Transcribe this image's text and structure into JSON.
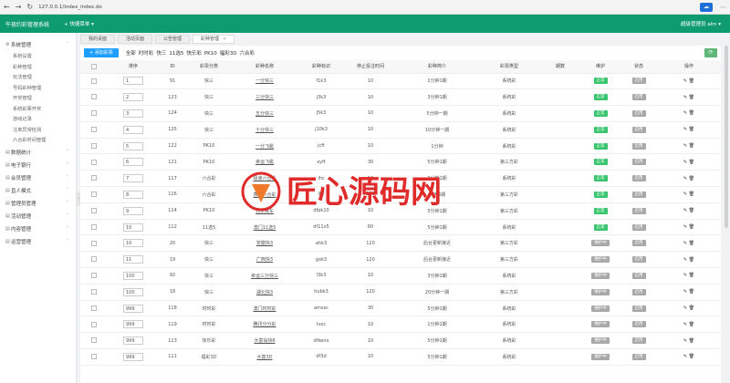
{
  "browser": {
    "url": "127.0.0.1/Index_index.do",
    "back": "←",
    "forward": "→",
    "reload": "↻",
    "menu": "⋯"
  },
  "header": {
    "brand": "午夜约彩管理系统",
    "quick_menu": "+ 快捷菜单 ▾",
    "user": "超级管理员   alm ▾"
  },
  "sidebar": {
    "groups": [
      {
        "label": "系统管理",
        "items": [
          "系统设置",
          "彩种管理",
          "玩法管理",
          "号码彩种管理",
          "开奖管理",
          "系统彩票开奖",
          "游戏记录",
          "注单异常检测",
          "六合彩时间管理"
        ]
      },
      {
        "label": "数据统计",
        "items": []
      },
      {
        "label": "电子银行",
        "items": []
      },
      {
        "label": "会员管理",
        "items": []
      },
      {
        "label": "直人模式",
        "items": []
      },
      {
        "label": "管理员管理",
        "items": []
      },
      {
        "label": "活动管理",
        "items": []
      },
      {
        "label": "内容管理",
        "items": []
      },
      {
        "label": "运营管理",
        "items": []
      }
    ]
  },
  "tabs": [
    "我的桌面",
    "活动页面",
    "公告管理",
    "彩种管理"
  ],
  "toolbar": {
    "add_label": "+ 添加彩票",
    "filters": [
      "全部",
      "时时彩",
      "快三",
      "11选5",
      "快乐彩",
      "PK10",
      "福彩3D",
      "六合彩"
    ],
    "refresh": "⟳"
  },
  "table": {
    "headers": [
      "",
      "排序",
      "ID",
      "彩票分类",
      "彩种名称",
      "彩种标识",
      "停止投注时间",
      "彩种简介",
      "彩票类型",
      "期数",
      "维护",
      "状态",
      "操作"
    ],
    "rows": [
      [
        "1",
        "91",
        "快三",
        "一分快三",
        "f1k3",
        "10",
        "1分钟1期",
        "系统彩",
        "",
        "正常",
        "启用"
      ],
      [
        "2",
        "123",
        "快三",
        "三分快三",
        "j3k3",
        "10",
        "3分钟1期",
        "系统彩",
        "",
        "正常",
        "启用"
      ],
      [
        "3",
        "124",
        "快三",
        "五分快三",
        "j5k3",
        "10",
        "5分钟一期",
        "系统彩",
        "",
        "正常",
        "启用"
      ],
      [
        "4",
        "125",
        "快三",
        "十分快三",
        "j10k3",
        "10",
        "10分钟一期",
        "系统彩",
        "",
        "正常",
        "启用"
      ],
      [
        "5",
        "122",
        "PK10",
        "一分飞艇",
        "jcft",
        "10",
        "1分钟",
        "系统彩",
        "",
        "正常",
        "启用"
      ],
      [
        "6",
        "121",
        "PK10",
        "幸运飞艇",
        "xyft",
        "30",
        "5分钟1期",
        "第三方彩",
        "",
        "正常",
        "启用"
      ],
      [
        "7",
        "117",
        "六合彩",
        "极速六合彩",
        "lhc",
        "10",
        "3分钟1期",
        "系统彩",
        "",
        "正常",
        "启用"
      ],
      [
        "8",
        "116",
        "六合彩",
        "香港六合彩",
        "lhc",
        "120",
        "两天3期",
        "第三方彩",
        "",
        "正常",
        "启用"
      ],
      [
        "9",
        "114",
        "PK10",
        "北京赛车",
        "dfpk10",
        "10",
        "5分钟1期",
        "第三方彩",
        "",
        "正常",
        "启用"
      ],
      [
        "10",
        "112",
        "11选5",
        "澳门11选5",
        "df11x5",
        "60",
        "5分钟1期",
        "系统彩",
        "",
        "正常",
        "启用"
      ],
      [
        "10",
        "20",
        "快三",
        "安徽快3",
        "ahk3",
        "120",
        "后台更新接近",
        "第三方彩",
        "",
        "维护中",
        "启用"
      ],
      [
        "11",
        "19",
        "快三",
        "广西快3",
        "gxk3",
        "120",
        "后台更新接近",
        "第三方彩",
        "",
        "维护中",
        "启用"
      ],
      [
        "100",
        "92",
        "快三",
        "幸运三分快三",
        "l3k3",
        "10",
        "3分钟1期",
        "系统彩",
        "",
        "维护中",
        "启用"
      ],
      [
        "100",
        "18",
        "快三",
        "湖北快3",
        "hubk3",
        "120",
        "20分钟一期",
        "第三方彩",
        "",
        "维护中",
        "启用"
      ],
      [
        "999",
        "118",
        "时时彩",
        "澳门时时彩",
        "amssc",
        "30",
        "5分钟1期",
        "系统彩",
        "",
        "维护中",
        "启用"
      ],
      [
        "999",
        "119",
        "时时彩",
        "腾讯分分彩",
        "txsc",
        "10",
        "1分钟1期",
        "系统彩",
        "",
        "维护中",
        "启用"
      ],
      [
        "999",
        "113",
        "快乐彩",
        "大富翁快8",
        "dfkeno",
        "10",
        "5分钟1期",
        "系统彩",
        "",
        "维护中",
        "启用"
      ],
      [
        "999",
        "111",
        "福彩3D",
        "大富3D",
        "df3d",
        "10",
        "5分钟1期",
        "系统彩",
        "",
        "维护中",
        "启用"
      ]
    ]
  },
  "watermark": "匠心源码网",
  "colors": {
    "primary": "#0e9b6d",
    "blue": "#1e9fff",
    "ok": "#38c56d",
    "muted": "#a8a8a8",
    "watermark": "#e02b2b"
  }
}
